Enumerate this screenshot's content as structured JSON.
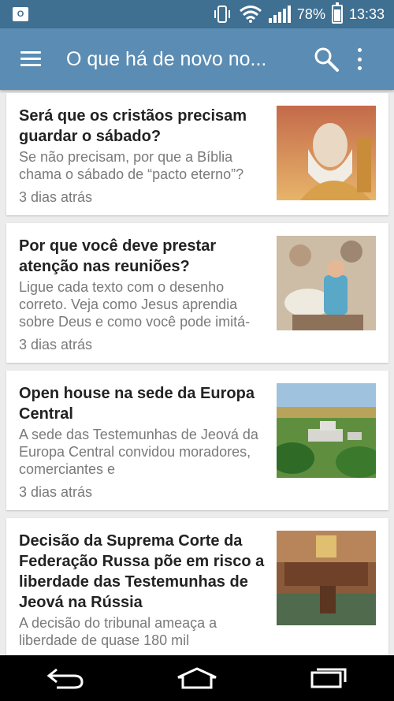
{
  "status_bar": {
    "battery": "78%",
    "time": "13:33",
    "notification_icon": "outlook-icon"
  },
  "app_bar": {
    "title": "O que há de novo no...",
    "menu_icon": "menu-icon",
    "search_icon": "search-icon",
    "more_icon": "more-options-icon"
  },
  "articles": [
    {
      "title": "Será que os cristãos precisam guardar o sábado?",
      "summary": "Se não precisam, por que a Bíblia chama o sábado de “pacto eterno”?",
      "date": "3 dias atrás"
    },
    {
      "title": "Por que você deve prestar atenção nas reuniões?",
      "summary": "Ligue cada texto com o desenho correto. Veja como Jesus aprendia sobre Deus e como você pode imitá-",
      "date": "3 dias atrás"
    },
    {
      "title": "Open house na sede da Europa Central",
      "summary": "A sede das Testemunhas de Jeová da Europa Central convidou moradores, comerciantes e",
      "date": "3 dias atrás"
    },
    {
      "title": "Decisão da Suprema Corte da Federação Russa põe em risco a liberdade das Testemunhas de Jeová na Rússia",
      "summary": "A decisão do tribunal ameaça a liberdade de quase 180 mil",
      "date": ""
    }
  ],
  "nav_bar": {
    "back_icon": "back-icon",
    "home_icon": "home-icon",
    "recents_icon": "recents-icon"
  },
  "colors": {
    "status_bar": "#3f6f91",
    "app_bar": "#5b8db4",
    "background": "#ececec"
  }
}
